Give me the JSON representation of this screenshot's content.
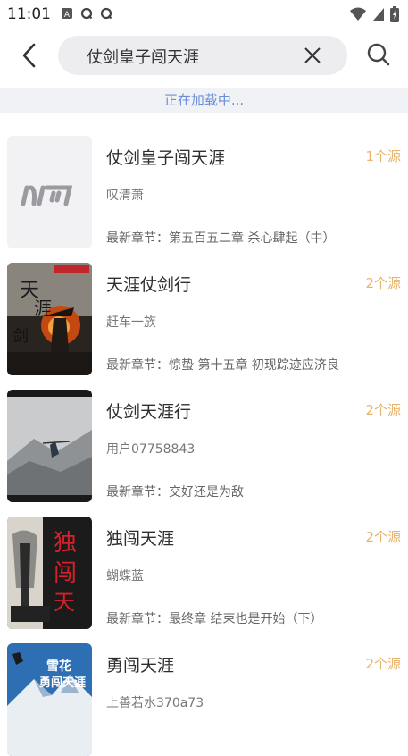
{
  "status": {
    "time": "11:01",
    "icons": [
      "a-icon",
      "q-icon",
      "q-icon"
    ],
    "right_icons": [
      "wifi-icon",
      "signal-icon",
      "battery-icon"
    ]
  },
  "header": {
    "query": "仗剑皇子闯天涯"
  },
  "loading_text": "正在加载中...",
  "books": [
    {
      "title": "仗剑皇子闯天涯",
      "author": "叹清萧",
      "latest_label": "最新章节：",
      "latest_chapter": "第五百五二章 杀心肆起（中）",
      "sources": "1个源",
      "cover": "placeholder-logo"
    },
    {
      "title": "天涯仗剑行",
      "author": "赶车一族",
      "latest_label": "最新章节：",
      "latest_chapter": "惊蛰 第十五章 初现踪迹应济良",
      "sources": "2个源",
      "cover": "warrior-fire"
    },
    {
      "title": "仗剑天涯行",
      "author": "用户07758843",
      "latest_label": "最新章节：",
      "latest_chapter": "交好还是为敌",
      "sources": "2个源",
      "cover": "mountain-ink"
    },
    {
      "title": "独闯天涯",
      "author": "蝴蝶蓝",
      "latest_label": "最新章节：",
      "latest_chapter": "最终章 结束也是开始（下）",
      "sources": "2个源",
      "cover": "red-calligraphy"
    },
    {
      "title": "勇闯天涯",
      "author": "上善若水370a73",
      "latest_label": "",
      "latest_chapter": "",
      "sources": "2个源",
      "cover": "snow-mountain"
    }
  ]
}
